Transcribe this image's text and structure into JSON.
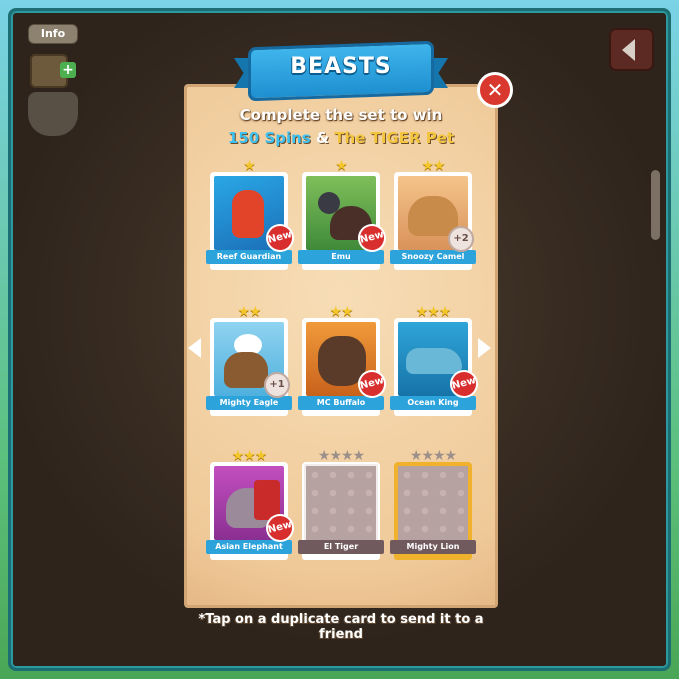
{
  "hud": {
    "info_label": "Info"
  },
  "popup": {
    "title": "BEASTS",
    "line1": "Complete the set to win",
    "reward_spins": "150 Spins",
    "reward_amp": "&",
    "reward_pet": "The TIGER Pet",
    "footer": "*Tap on a duplicate card to send it to a friend"
  },
  "cards": [
    {
      "name": "Reef Guardian",
      "stars": 1,
      "badge": "New",
      "owned": true
    },
    {
      "name": "Emu",
      "stars": 1,
      "badge": "New",
      "owned": true
    },
    {
      "name": "Snoozy Camel",
      "stars": 2,
      "badge": "+2",
      "owned": true
    },
    {
      "name": "Mighty Eagle",
      "stars": 2,
      "badge": "+1",
      "owned": true
    },
    {
      "name": "MC Buffalo",
      "stars": 2,
      "badge": "New",
      "owned": true
    },
    {
      "name": "Ocean King",
      "stars": 3,
      "badge": "New",
      "owned": true
    },
    {
      "name": "Asian Elephant",
      "stars": 3,
      "badge": "New",
      "owned": true
    },
    {
      "name": "El Tiger",
      "stars": 4,
      "badge": "",
      "owned": false
    },
    {
      "name": "Mighty Lion",
      "stars": 4,
      "badge": "",
      "owned": false
    }
  ],
  "colors": {
    "banner": "#2aa3e0",
    "label_owned": "#2da3dc",
    "label_locked": "#705a5e",
    "badge_new": "#d92e2e",
    "star": "#f3c62b",
    "gold_frame": "#f0b22c"
  }
}
